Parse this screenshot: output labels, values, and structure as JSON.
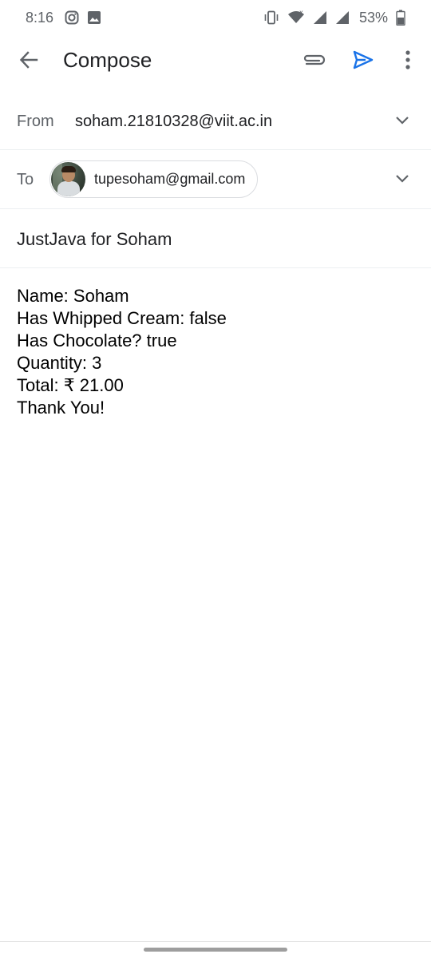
{
  "status_bar": {
    "time": "8:16",
    "battery_percent": "53%",
    "icons": [
      "instagram-icon",
      "gallery-icon",
      "vibrate-icon",
      "wifi-icon",
      "signal-icon",
      "signal-icon",
      "battery-icon"
    ]
  },
  "app_bar": {
    "title": "Compose",
    "icons": [
      "back-arrow-icon",
      "attachment-icon",
      "send-icon",
      "more-vert-icon"
    ],
    "accent_color": "#1a73e8"
  },
  "from": {
    "label": "From",
    "value": "soham.21810328@viit.ac.in"
  },
  "to": {
    "label": "To",
    "recipients": [
      {
        "email": "tupesoham@gmail.com"
      }
    ]
  },
  "subject": "JustJava for Soham",
  "body": {
    "lines": [
      "Name: Soham",
      "Has Whipped Cream: false",
      "Has Chocolate? true",
      "Quantity: 3",
      "Total: ₹ 21.00",
      "Thank You!"
    ]
  }
}
